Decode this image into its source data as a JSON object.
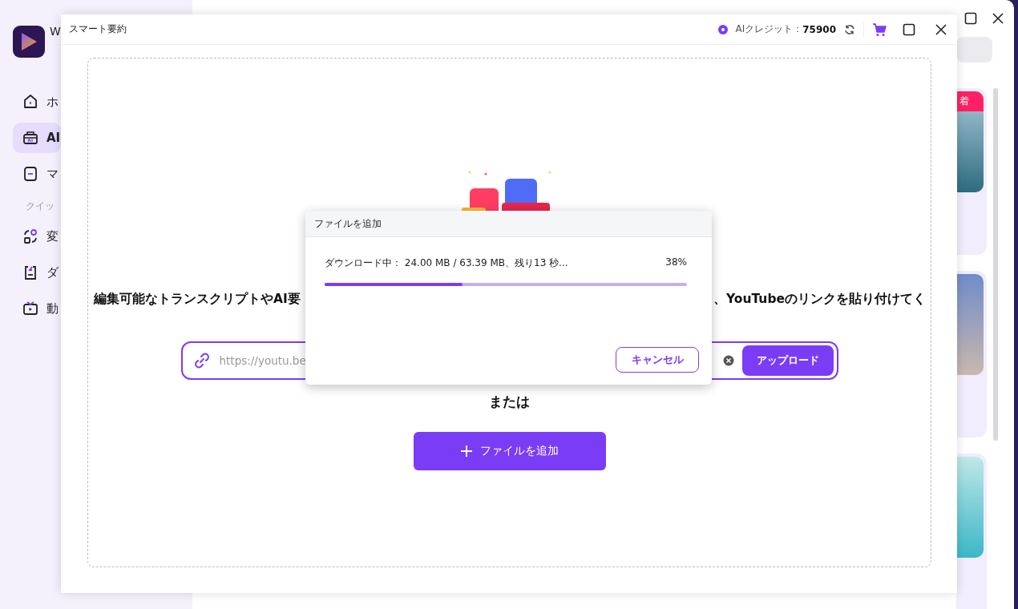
{
  "app": {
    "logo_text": "W",
    "nav": [
      {
        "label": "ホ",
        "selected": false
      },
      {
        "label": "AI",
        "selected": true
      },
      {
        "label": "マ",
        "selected": false
      }
    ],
    "section_label": "クイッ",
    "quick": [
      {
        "label": "変"
      },
      {
        "label": "ダ"
      },
      {
        "label": "動"
      }
    ],
    "cards": [
      {
        "new": true,
        "badge": "着"
      },
      {
        "new": false
      },
      {
        "new": false
      }
    ]
  },
  "modal": {
    "title": "スマート要約",
    "credits_label": "AIクレジット：",
    "credits_value": "75900",
    "heading_left": "編集可能なトランスクリプトやAI要",
    "heading_right": "、YouTubeのリンクを貼り付けてく",
    "url_placeholder": "https://youtu.be",
    "upload_button": "アップロード",
    "or_label": "または",
    "add_file_button": "ファイルを追加"
  },
  "dialog": {
    "title": "ファイルを追加",
    "status": "ダウンロード中： 24.00 MB / 63.39 MB、残り13 秒...",
    "percent": "38%",
    "level": 0.38,
    "cancel_button": "キャンセル"
  }
}
